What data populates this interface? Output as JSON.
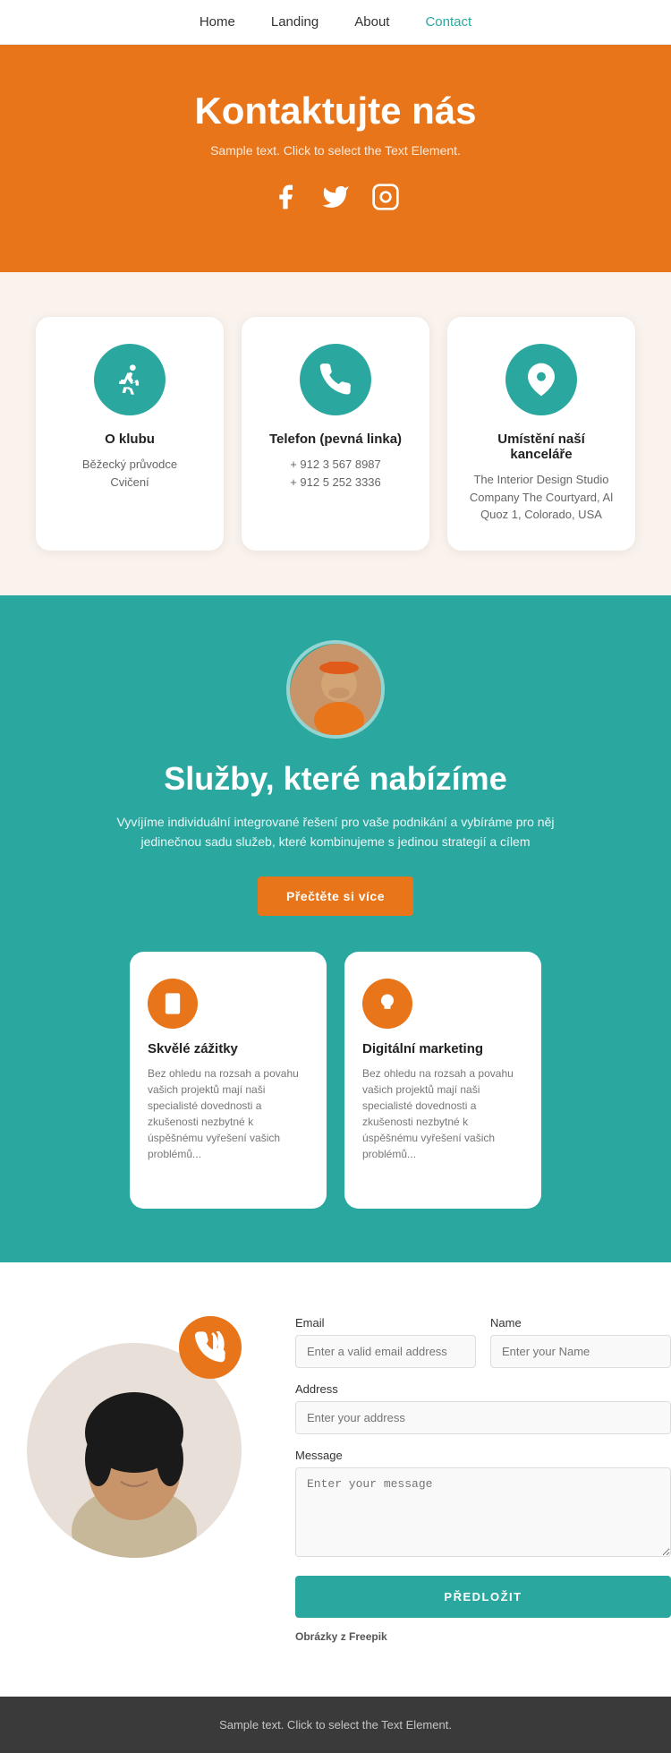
{
  "nav": {
    "links": [
      {
        "label": "Home",
        "href": "#",
        "active": false
      },
      {
        "label": "Landing",
        "href": "#",
        "active": false
      },
      {
        "label": "About",
        "href": "#",
        "active": false
      },
      {
        "label": "Contact",
        "href": "#",
        "active": true
      }
    ]
  },
  "hero": {
    "title": "Kontaktujte nás",
    "subtitle": "Sample text. Click to select the Text Element.",
    "social": {
      "facebook": "f",
      "twitter": "🐦",
      "instagram": "📷"
    }
  },
  "cards": [
    {
      "icon": "runner",
      "title": "O klubu",
      "lines": [
        "Běžecký průvodce",
        "Cvičení"
      ]
    },
    {
      "icon": "phone",
      "title": "Telefon (pevná linka)",
      "lines": [
        "+ 912 3 567 8987",
        "+ 912 5 252 3336"
      ]
    },
    {
      "icon": "location",
      "title": "Umístění naší kanceláře",
      "lines": [
        "The Interior Design Studio Company The Courtyard, Al Quoz 1, Colorado, USA"
      ]
    }
  ],
  "services": {
    "title": "Služby, které nabízíme",
    "description": "Vyvíjíme individuální integrované řešení pro vaše podnikání a vybíráme pro něj jedinečnou sadu služeb, které kombinujeme s jedinou strategií a cílem",
    "button_label": "Přečtěte si více",
    "items": [
      {
        "icon": "mobile",
        "title": "Skvělé zážitky",
        "description": "Bez ohledu na rozsah a povahu vašich projektů mají naši specialisté dovednosti a zkušenosti nezbytné k úspěšnému vyřešení vašich problémů..."
      },
      {
        "icon": "bulb",
        "title": "Digitální marketing",
        "description": "Bez ohledu na rozsah a povahu vašich projektů mají naši specialisté dovednosti a zkušenosti nezbytné k úspěšnému vyřešení vašich problémů..."
      }
    ]
  },
  "contact": {
    "form": {
      "email_label": "Email",
      "email_placeholder": "Enter a valid email address",
      "name_label": "Name",
      "name_placeholder": "Enter your Name",
      "address_label": "Address",
      "address_placeholder": "Enter your address",
      "message_label": "Message",
      "message_placeholder": "Enter your message",
      "submit_label": "PŘEDLOŽIT",
      "note": "Obrázky z",
      "note_brand": "Freepik"
    }
  },
  "footer": {
    "text": "Sample text. Click to select the Text Element."
  }
}
